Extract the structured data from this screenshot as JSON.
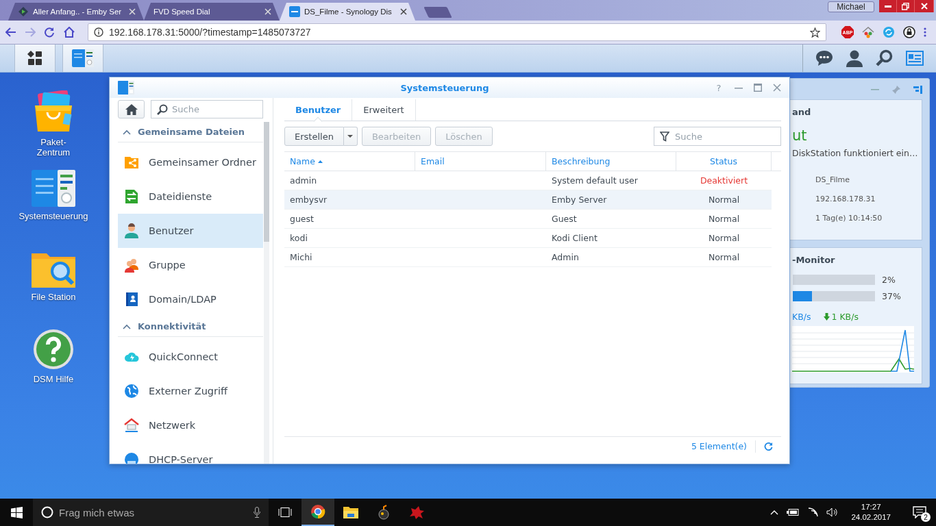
{
  "browser": {
    "tabs": [
      {
        "title": "Aller Anfang.. - Emby Ser",
        "kind": "emby",
        "selected": false
      },
      {
        "title": "FVD Speed Dial",
        "kind": "plain",
        "selected": false
      },
      {
        "title": "DS_Filme - Synology Dis",
        "kind": "dsm",
        "selected": true
      }
    ],
    "user": "Michael",
    "address": "192.168.178.31:5000/?timestamp=1485073727",
    "extension_badge": "ABP"
  },
  "desktop_icons": [
    {
      "label": "Paket-\nZentrum",
      "kind": "package"
    },
    {
      "label": "Systemsteuerung",
      "kind": "control-panel"
    },
    {
      "label": "File Station",
      "kind": "file-station"
    },
    {
      "label": "DSM Hilfe",
      "kind": "help"
    }
  ],
  "widget_panel": {
    "heading": "and",
    "status": "ut",
    "status_text": "DiskStation funktioniert ein…",
    "info": [
      "DS_Filme",
      "192.168.178.31",
      "1 Tag(e) 10:14:50"
    ],
    "monitor_heading": "-Monitor",
    "meters": [
      {
        "level": 0,
        "reading": "2%"
      },
      {
        "level": 0.23,
        "reading": "37%"
      }
    ],
    "upload": "KB/s",
    "download": "1 KB/s"
  },
  "window": {
    "title": "Systemsteuerung",
    "help": "?",
    "search_placeholder": "Suche",
    "sidebar": [
      {
        "heading": "Gemeinsame Dateien",
        "expanded": true,
        "items": [
          {
            "label": "Gemeinsamer Ordner",
            "kind": "shared-folder",
            "selected": false
          },
          {
            "label": "Dateidienste",
            "kind": "file-services",
            "selected": false
          },
          {
            "label": "Benutzer",
            "kind": "user",
            "selected": true
          },
          {
            "label": "Gruppe",
            "kind": "group",
            "selected": false
          },
          {
            "label": "Domain/LDAP",
            "kind": "domain",
            "selected": false
          }
        ]
      },
      {
        "heading": "Konnektivität",
        "expanded": true,
        "items": [
          {
            "label": "QuickConnect",
            "kind": "quickconnect",
            "selected": false
          },
          {
            "label": "Externer Zugriff",
            "kind": "globe",
            "selected": false
          },
          {
            "label": "Netzwerk",
            "kind": "network",
            "selected": false
          },
          {
            "label": "DHCP-Server",
            "kind": "dhcp",
            "selected": false
          }
        ]
      }
    ],
    "tabs": [
      {
        "label": "Benutzer",
        "selected": true
      },
      {
        "label": "Erweitert",
        "selected": false
      }
    ],
    "toolbar": [
      {
        "label": "Erstellen",
        "disabled": false,
        "dropdown": true
      },
      {
        "label": "Bearbeiten",
        "disabled": true,
        "dropdown": false
      },
      {
        "label": "Löschen",
        "disabled": true,
        "dropdown": false
      }
    ],
    "filter_placeholder": "Suche",
    "columns": [
      {
        "label": "Name",
        "sorted": true
      },
      {
        "label": "Email",
        "sorted": false
      },
      {
        "label": "Beschreibung",
        "sorted": false
      },
      {
        "label": "Status",
        "sorted": false
      }
    ],
    "rows": [
      {
        "name": "admin",
        "description": "System default user",
        "status": "Deaktiviert",
        "alert": true,
        "selected": false
      },
      {
        "name": "embysvr",
        "description": "Emby Server",
        "status": "Normal",
        "alert": false,
        "selected": true
      },
      {
        "name": "guest",
        "description": "Guest",
        "status": "Normal",
        "alert": false,
        "selected": false
      },
      {
        "name": "kodi",
        "description": "Kodi Client",
        "status": "Normal",
        "alert": false,
        "selected": false
      },
      {
        "name": "Michi",
        "description": "Admin",
        "status": "Normal",
        "alert": false,
        "selected": false
      }
    ],
    "footer": "5 Element(e)"
  },
  "taskbar": {
    "search_placeholder": "Frag mich etwas",
    "time": "17:27",
    "date": "24.02.2017",
    "notifications": "2"
  }
}
